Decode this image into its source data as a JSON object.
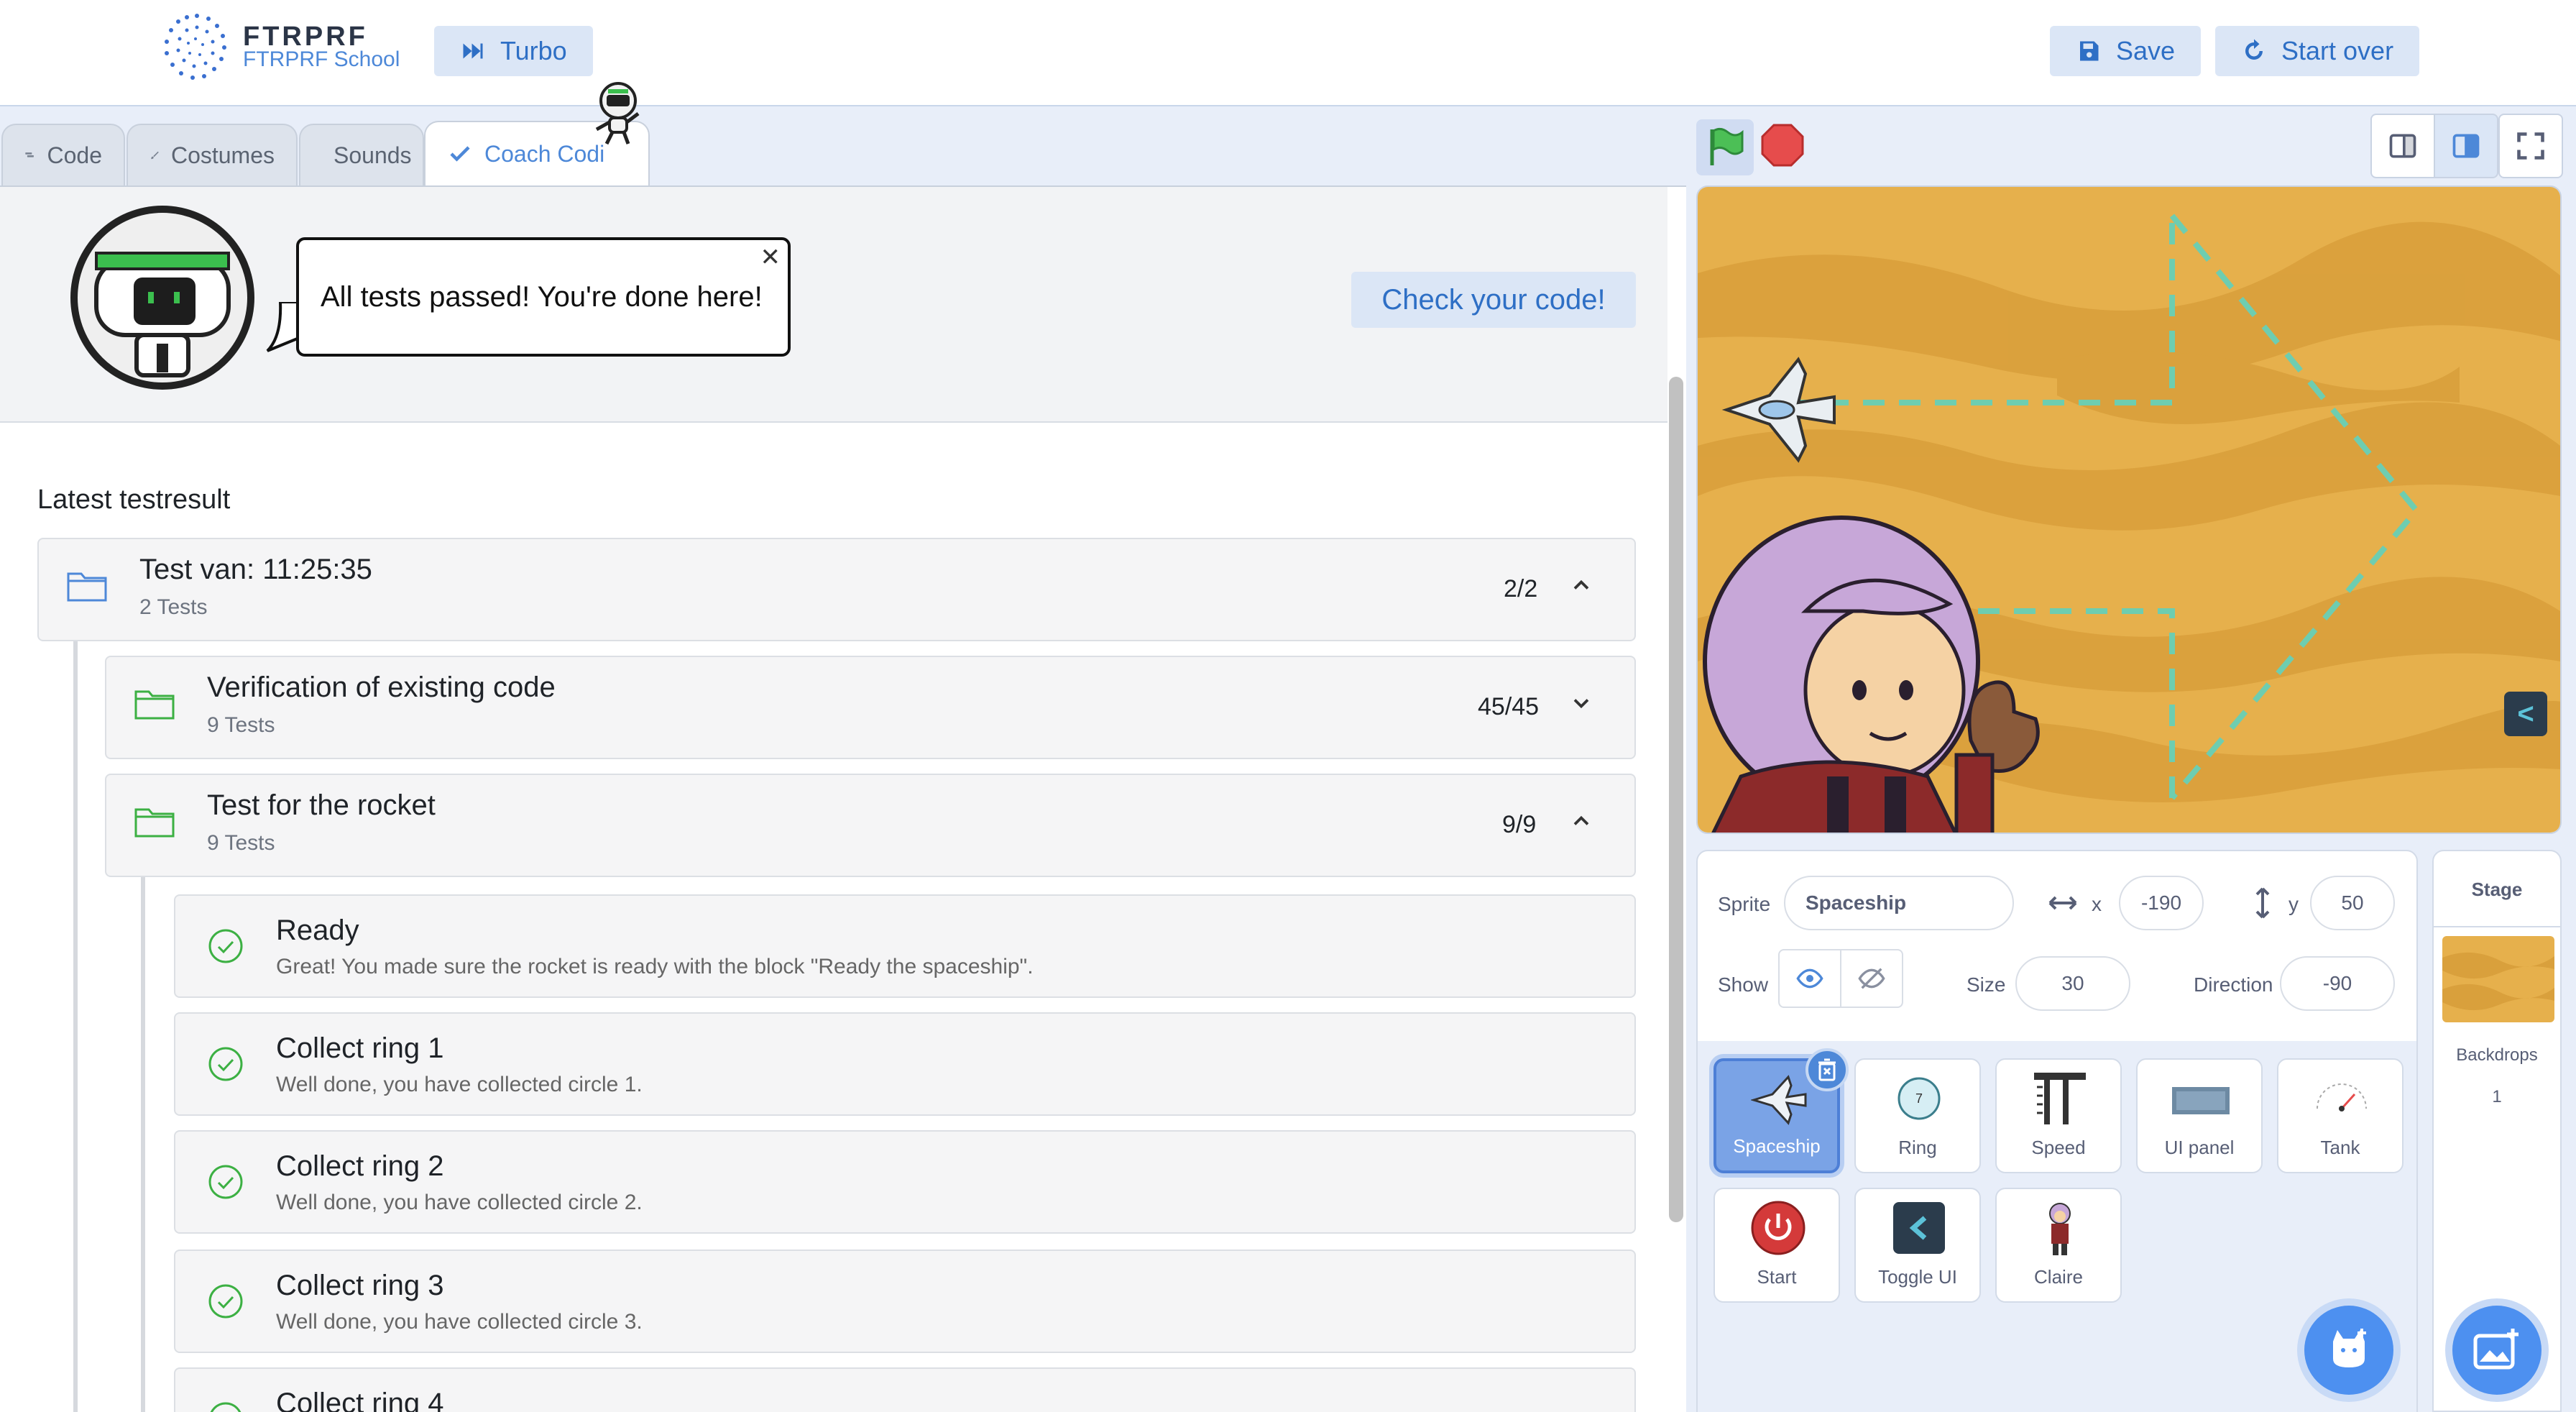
{
  "header": {
    "brand_name": "FTRPRF",
    "brand_sub": "FTRPRF School",
    "turbo_label": "Turbo",
    "save_label": "Save",
    "start_over_label": "Start over"
  },
  "tabs": [
    {
      "label": "Code",
      "active": false
    },
    {
      "label": "Costumes",
      "active": false
    },
    {
      "label": "Sounds",
      "active": false
    },
    {
      "label": "Coach Codi",
      "active": true
    }
  ],
  "coach": {
    "message": "All tests passed! You're done here!",
    "check_button": "Check your code!"
  },
  "results": {
    "heading": "Latest testresult",
    "group": {
      "title": "Test van: 11:25:35",
      "subtitle": "2 Tests",
      "score": "2/2"
    },
    "suites": [
      {
        "title": "Verification of existing code",
        "subtitle": "9 Tests",
        "score": "45/45",
        "expanded": false
      },
      {
        "title": "Test for the rocket",
        "subtitle": "9 Tests",
        "score": "9/9",
        "expanded": true
      }
    ],
    "tests": [
      {
        "title": "Ready",
        "message": "Great! You made sure the rocket is ready with the block \"Ready the spaceship\"."
      },
      {
        "title": "Collect ring 1",
        "message": "Well done, you have collected circle 1."
      },
      {
        "title": "Collect ring 2",
        "message": "Well done, you have collected circle 2."
      },
      {
        "title": "Collect ring 3",
        "message": "Well done, you have collected circle 3."
      },
      {
        "title": "Collect ring 4",
        "message": ""
      }
    ]
  },
  "stage": {
    "toggle_label": "<"
  },
  "sprite_info": {
    "sprite_label": "Sprite",
    "sprite_name": "Spaceship",
    "x_label": "x",
    "x_value": "-190",
    "y_label": "y",
    "y_value": "50",
    "show_label": "Show",
    "size_label": "Size",
    "size_value": "30",
    "direction_label": "Direction",
    "direction_value": "-90"
  },
  "sprites": [
    {
      "name": "Spaceship",
      "icon": "spaceship-icon",
      "selected": true
    },
    {
      "name": "Ring",
      "icon": "ring-icon",
      "selected": false
    },
    {
      "name": "Speed",
      "icon": "speed-icon",
      "selected": false
    },
    {
      "name": "UI panel",
      "icon": "ui-panel-icon",
      "selected": false
    },
    {
      "name": "Tank",
      "icon": "tank-icon",
      "selected": false
    },
    {
      "name": "Start",
      "icon": "power-icon",
      "selected": false
    },
    {
      "name": "Toggle UI",
      "icon": "toggle-ui-icon",
      "selected": false
    },
    {
      "name": "Claire",
      "icon": "claire-icon",
      "selected": false
    }
  ],
  "stage_pane": {
    "title": "Stage",
    "backdrops_label": "Backdrops",
    "backdrops_count": "1"
  },
  "colors": {
    "accent": "#4d88d8",
    "success": "#3cb043",
    "panel_bg": "#e8eef9",
    "sand": "#e4ad45"
  }
}
